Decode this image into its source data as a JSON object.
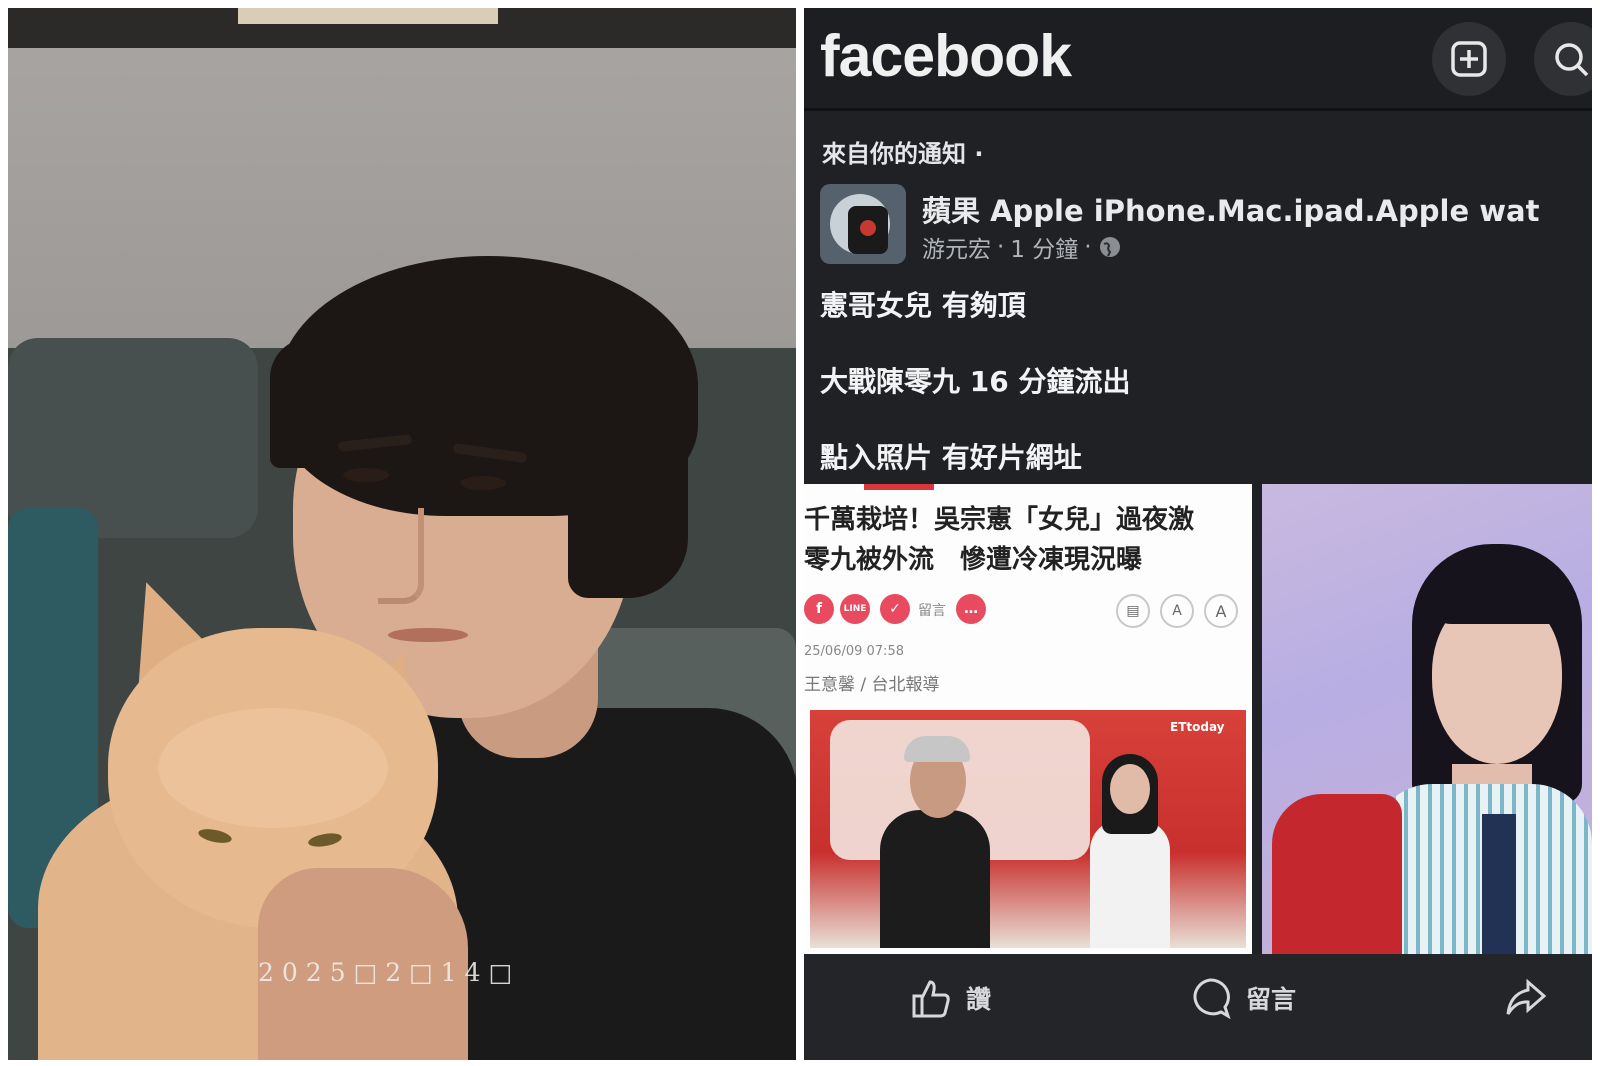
{
  "photo": {
    "date_stamp": "2025□2□14□"
  },
  "facebook": {
    "logo": "facebook",
    "header_buttons": [
      "plus-square-icon",
      "search-icon"
    ],
    "notification_label": "來自你的通知 ·",
    "post": {
      "group_name": "蘋果 Apple  iPhone.Mac.ipad.Apple wat",
      "author": "游元宏",
      "separator": "·",
      "time": "1 分鐘",
      "visibility": "globe-icon",
      "lines": [
        "憲哥女兒 有夠頂",
        "大戰陳零九 16 分鐘流出",
        "點入照片 有好片網址"
      ],
      "article": {
        "headline_1": "千萬栽培！吳宗憲「女兒」過夜激",
        "headline_2": "零九被外流　慘遭冷凍現況曝",
        "share_label": "留言",
        "date": "25/06/09 07:58",
        "byline": "王意馨 / 台北報導",
        "image_badge": "ETtoday"
      }
    },
    "actions": {
      "like": "讚",
      "comment": "留言"
    },
    "colors": {
      "background": "#1f2124",
      "text": "#e4e6eb",
      "muted": "#b0b3b8"
    }
  }
}
